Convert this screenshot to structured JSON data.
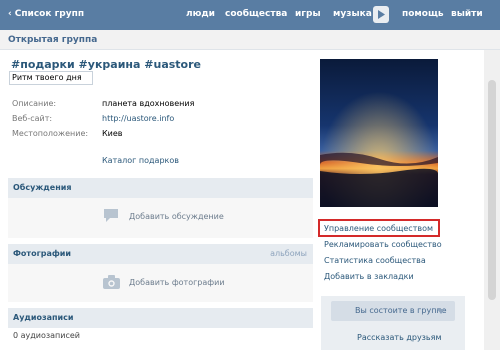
{
  "topbar": {
    "back_label": "Список групп",
    "nav": [
      "люди",
      "сообщества",
      "игры",
      "музыка",
      "помощь",
      "выйти"
    ]
  },
  "page_title": "Открытая группа",
  "group": {
    "status": "#подарки #украина #uastore",
    "subtitle": "Ритм твоего дня",
    "info": [
      {
        "label": "Описание:",
        "value": "планета вдохновения"
      },
      {
        "label": "Веб-сайт:",
        "value": "http://uastore.info"
      },
      {
        "label": "Местоположение:",
        "value": "Киев"
      }
    ],
    "gift_catalog": "Каталог подарков"
  },
  "sections": {
    "discussions": {
      "title": "Обсуждения",
      "action": "Добавить обсуждение"
    },
    "photos": {
      "title": "Фотографии",
      "right": "альбомы",
      "action": "Добавить фотографии"
    },
    "audio": {
      "title": "Аудиозаписи",
      "count": "0 аудиозаписей"
    }
  },
  "sidebar": {
    "links": [
      "Управление сообществом",
      "Рекламировать сообщество",
      "Статистика сообщества",
      "Добавить в закладки"
    ],
    "member_button": "Вы состоите в группе",
    "tell_friends": "Рассказать друзьям"
  },
  "colors": {
    "topbar": "#597da3",
    "link": "#2b587a",
    "highlight": "#d42a2a"
  }
}
